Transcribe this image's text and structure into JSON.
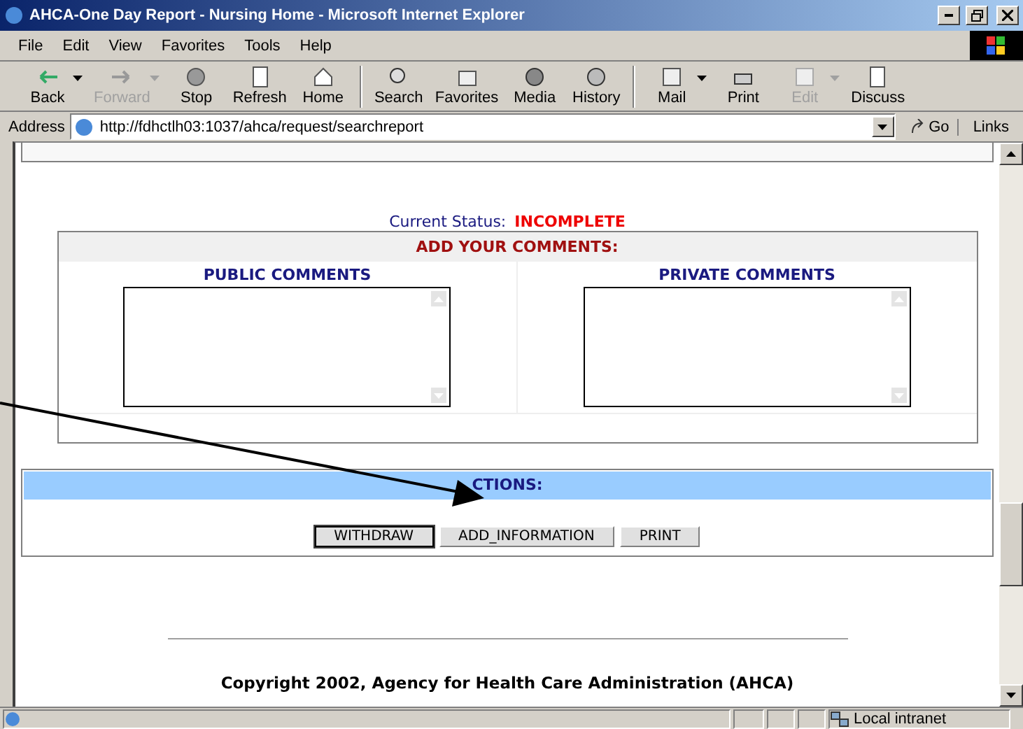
{
  "window": {
    "title": "AHCA-One Day Report - Nursing Home - Microsoft Internet Explorer"
  },
  "menu": [
    "File",
    "Edit",
    "View",
    "Favorites",
    "Tools",
    "Help"
  ],
  "toolbar": [
    [
      {
        "label": "Back",
        "disabled": false,
        "dropdown": true
      },
      {
        "label": "Forward",
        "disabled": true,
        "dropdown": true
      },
      {
        "label": "Stop",
        "disabled": false,
        "dropdown": false
      },
      {
        "label": "Refresh",
        "disabled": false,
        "dropdown": false
      },
      {
        "label": "Home",
        "disabled": false,
        "dropdown": false
      }
    ],
    [
      {
        "label": "Search",
        "disabled": false,
        "dropdown": false
      },
      {
        "label": "Favorites",
        "disabled": false,
        "dropdown": false
      },
      {
        "label": "Media",
        "disabled": false,
        "dropdown": false
      },
      {
        "label": "History",
        "disabled": false,
        "dropdown": false
      }
    ],
    [
      {
        "label": "Mail",
        "disabled": false,
        "dropdown": true
      },
      {
        "label": "Print",
        "disabled": false,
        "dropdown": false
      },
      {
        "label": "Edit",
        "disabled": true,
        "dropdown": true
      },
      {
        "label": "Discuss",
        "disabled": false,
        "dropdown": false
      }
    ]
  ],
  "address": {
    "label": "Address",
    "value": "http://fdhctlh03:1037/ahca/request/searchreport",
    "go": "Go",
    "links": "Links"
  },
  "status_line": {
    "label": "Current Status:",
    "value": "INCOMPLETE"
  },
  "comments": {
    "title": "ADD YOUR COMMENTS:",
    "columns": [
      {
        "heading": "PUBLIC COMMENTS"
      },
      {
        "heading": "PRIVATE COMMENTS"
      }
    ]
  },
  "actions": {
    "title": "CTIONS:",
    "buttons": [
      {
        "label": "WITHDRAW",
        "focused": true
      },
      {
        "label": "ADD_INFORMATION",
        "focused": false
      },
      {
        "label": "PRINT",
        "focused": false
      }
    ]
  },
  "footer": {
    "copyright": "Copyright 2002, Agency for Health Care Administration (AHCA)"
  },
  "status_bar": {
    "zone": "Local intranet"
  }
}
